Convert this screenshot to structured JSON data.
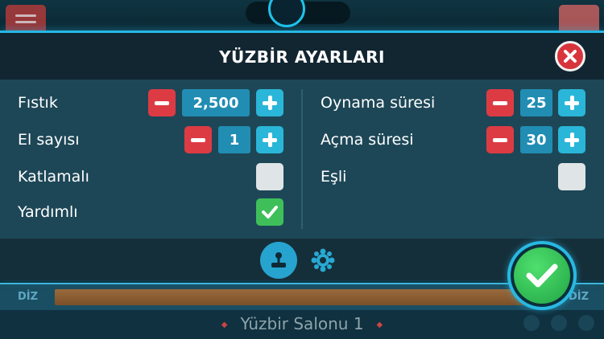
{
  "dialog": {
    "title": "YÜZBİR AYARLARI"
  },
  "settings_left": [
    {
      "label": "Fıstık",
      "value": "2,500"
    },
    {
      "label": "El sayısı",
      "value": "1"
    },
    {
      "label": "Katlamalı",
      "checked": false
    },
    {
      "label": "Yardımlı",
      "checked": true
    }
  ],
  "settings_right": [
    {
      "label": "Oynama süresi",
      "value": "25"
    },
    {
      "label": "Açma süresi",
      "value": "30"
    },
    {
      "label": "Eşli",
      "checked": false
    }
  ],
  "background": {
    "side_label_left": "DİZ",
    "side_label_right": "DİZ",
    "salon_name": "Yüzbir Salonu 1"
  },
  "colors": {
    "accent": "#25b8e4",
    "minus": "#dd3b44",
    "plus": "#2ab6d8",
    "checked": "#3ebf5a",
    "confirm": "#21a444"
  },
  "icons": {
    "close": "close-icon",
    "game_tab": "joystick-icon",
    "players_tab": "players-icon",
    "confirm": "check-icon"
  }
}
